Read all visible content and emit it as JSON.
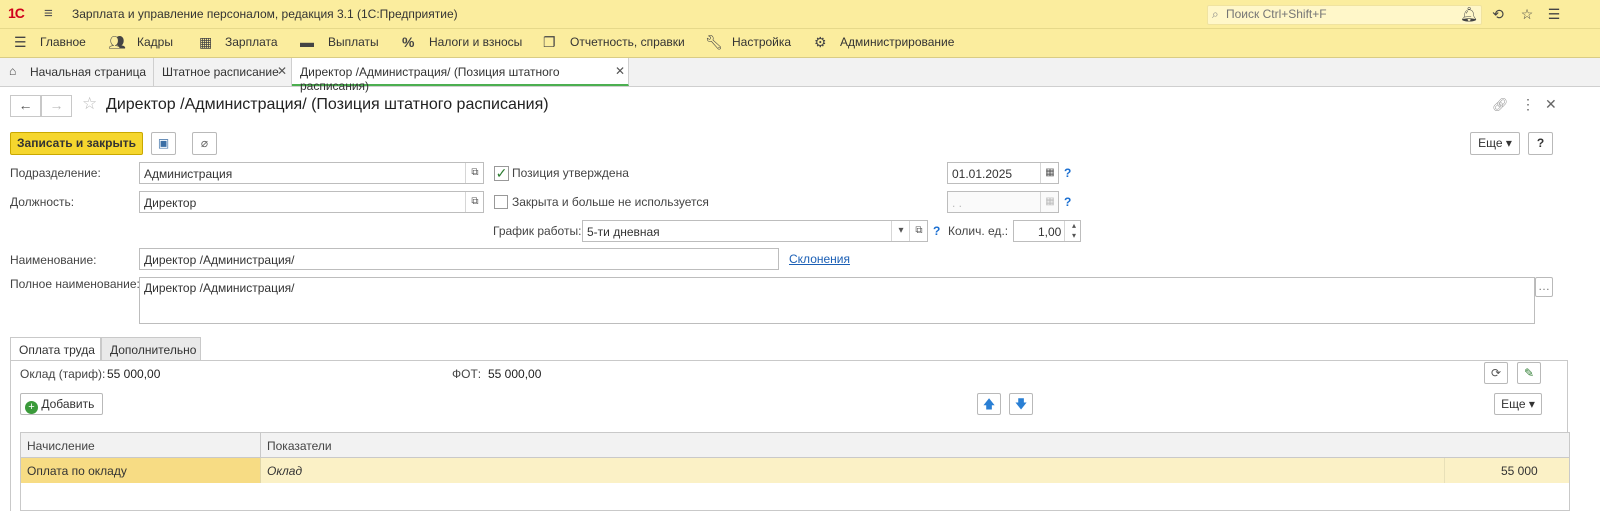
{
  "app": {
    "logo": "1С",
    "title": "Зарплата и управление персоналом, редакция 3.1  (1С:Предприятие)",
    "search_placeholder": "Поиск Ctrl+Shift+F"
  },
  "menu": [
    {
      "label": "Главное",
      "icon": "menu-icon"
    },
    {
      "label": "Кадры",
      "icon": "people-icon"
    },
    {
      "label": "Зарплата",
      "icon": "calculator-icon"
    },
    {
      "label": "Выплаты",
      "icon": "wallet-icon"
    },
    {
      "label": "Налоги и взносы",
      "icon": "percent-icon"
    },
    {
      "label": "Отчетность, справки",
      "icon": "documents-icon"
    },
    {
      "label": "Настройка",
      "icon": "wrench-icon"
    },
    {
      "label": "Администрирование",
      "icon": "gear-icon"
    }
  ],
  "tabs": [
    {
      "label": "Начальная страница"
    },
    {
      "label": "Штатное расписание"
    },
    {
      "label": "Директор /Администрация/ (Позиция штатного расписания)"
    }
  ],
  "form": {
    "title": "Директор /Администрация/ (Позиция штатного расписания)",
    "save_close": "Записать и закрыть",
    "more": "Еще",
    "help": "?",
    "division_label": "Подразделение:",
    "division_value": "Администрация",
    "position_label": "Должность:",
    "position_value": "Директор",
    "approved_label": "Позиция утверждена",
    "approved_date": "01.01.2025",
    "closed_label": "Закрыта и больше не используется",
    "closed_date": " .  .",
    "schedule_label": "График работы:",
    "schedule_value": "5-ти дневная",
    "qty_label": "Колич. ед.:",
    "qty_value": "1,00",
    "name_label": "Наименование:",
    "name_value": "Директор /Администрация/",
    "declensions_link": "Склонения",
    "fullname_label": "Полное наименование:",
    "fullname_value": "Директор /Администрация/",
    "qmark": "?"
  },
  "inner_tabs": [
    {
      "label": "Оплата труда"
    },
    {
      "label": "Дополнительно"
    }
  ],
  "payment": {
    "salary_label": "Оклад (тариф):",
    "salary_value": "55 000,00",
    "fot_label": "ФОТ:",
    "fot_value": "55 000,00",
    "add_label": "Добавить",
    "more": "Еще"
  },
  "grid": {
    "columns": [
      "Начисление",
      "Показатели"
    ],
    "rows": [
      {
        "accrual": "Оплата по окладу",
        "indicator": "Оклад",
        "value": "55 000"
      }
    ]
  }
}
